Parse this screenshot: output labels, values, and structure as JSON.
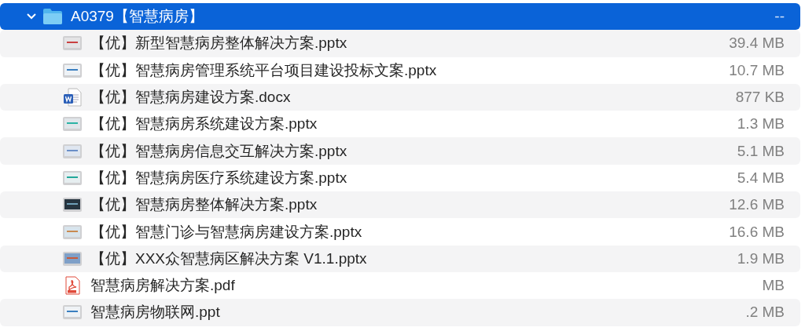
{
  "folder": {
    "name": "A0379【智慧病房】",
    "size": "--",
    "selected": true,
    "expanded": true,
    "children": [
      {
        "name": "【优】新型智慧病房整体解决方案.pptx",
        "size": "39.4 MB",
        "kind": "slides",
        "selected": false
      },
      {
        "name": "【优】智慧病房管理系统平台项目建设投标文案.pptx",
        "size": "10.7 MB",
        "kind": "slides",
        "selected": false
      },
      {
        "name": "【优】智慧病房建设方案.docx",
        "size": "877 KB",
        "kind": "word",
        "selected": false
      },
      {
        "name": "【优】智慧病房系统建设方案.pptx",
        "size": "1.3 MB",
        "kind": "slides",
        "selected": false
      },
      {
        "name": "【优】智慧病房信息交互解决方案.pptx",
        "size": "5.1 MB",
        "kind": "slides",
        "selected": false
      },
      {
        "name": "【优】智慧病房医疗系统建设方案.pptx",
        "size": "5.4 MB",
        "kind": "slides",
        "selected": false
      },
      {
        "name": "【优】智慧病房整体解决方案.pptx",
        "size": "12.6 MB",
        "kind": "slides",
        "selected": false
      },
      {
        "name": "【优】智慧门诊与智慧病房建设方案.pptx",
        "size": "16.6 MB",
        "kind": "slides",
        "selected": false
      },
      {
        "name": "【优】XXX众智慧病区解决方案 V1.1.pptx",
        "size": "1.9 MB",
        "kind": "slides",
        "selected": false
      },
      {
        "name": "智慧病房解决方案.pdf",
        "size": "MB",
        "kind": "pdf",
        "selected": false
      },
      {
        "name": "智慧病房物联网.ppt",
        "size": ".2 MB",
        "kind": "slides",
        "selected": false
      }
    ]
  }
}
